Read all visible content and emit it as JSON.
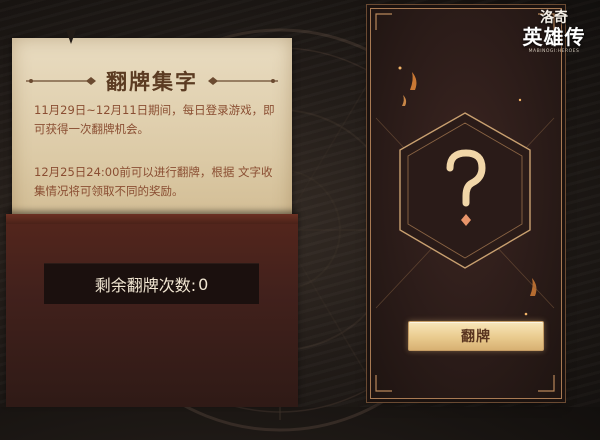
{
  "notice": {
    "title": "翻牌集字",
    "paragraph1": "11月29日~12月11日期间，每日登录游戏，即可获得一次翻牌机会。",
    "paragraph2": "12月25日24:00前可以进行翻牌，根据 文字收集情况将可领取不同的奖励。"
  },
  "counter": {
    "label": "剩余翻牌次数:",
    "value": "0"
  },
  "card": {
    "symbol": "?",
    "button_label": "翻牌"
  },
  "logo": {
    "line1": "洛奇",
    "line2": "英雄传",
    "line3": "MABINOGI:HEROES"
  },
  "colors": {
    "parchment": "#e2d2b2",
    "notice_text": "#8a4e32",
    "title_text": "#5b3b22",
    "sleeve": "#42211c",
    "card_bg": "#2a1b18",
    "card_border": "#a87a53",
    "button_gold": "#e9cb8e"
  },
  "icons": {
    "card_symbol": "question-mark-icon",
    "title_ornament": "ornament-divider-icon"
  }
}
